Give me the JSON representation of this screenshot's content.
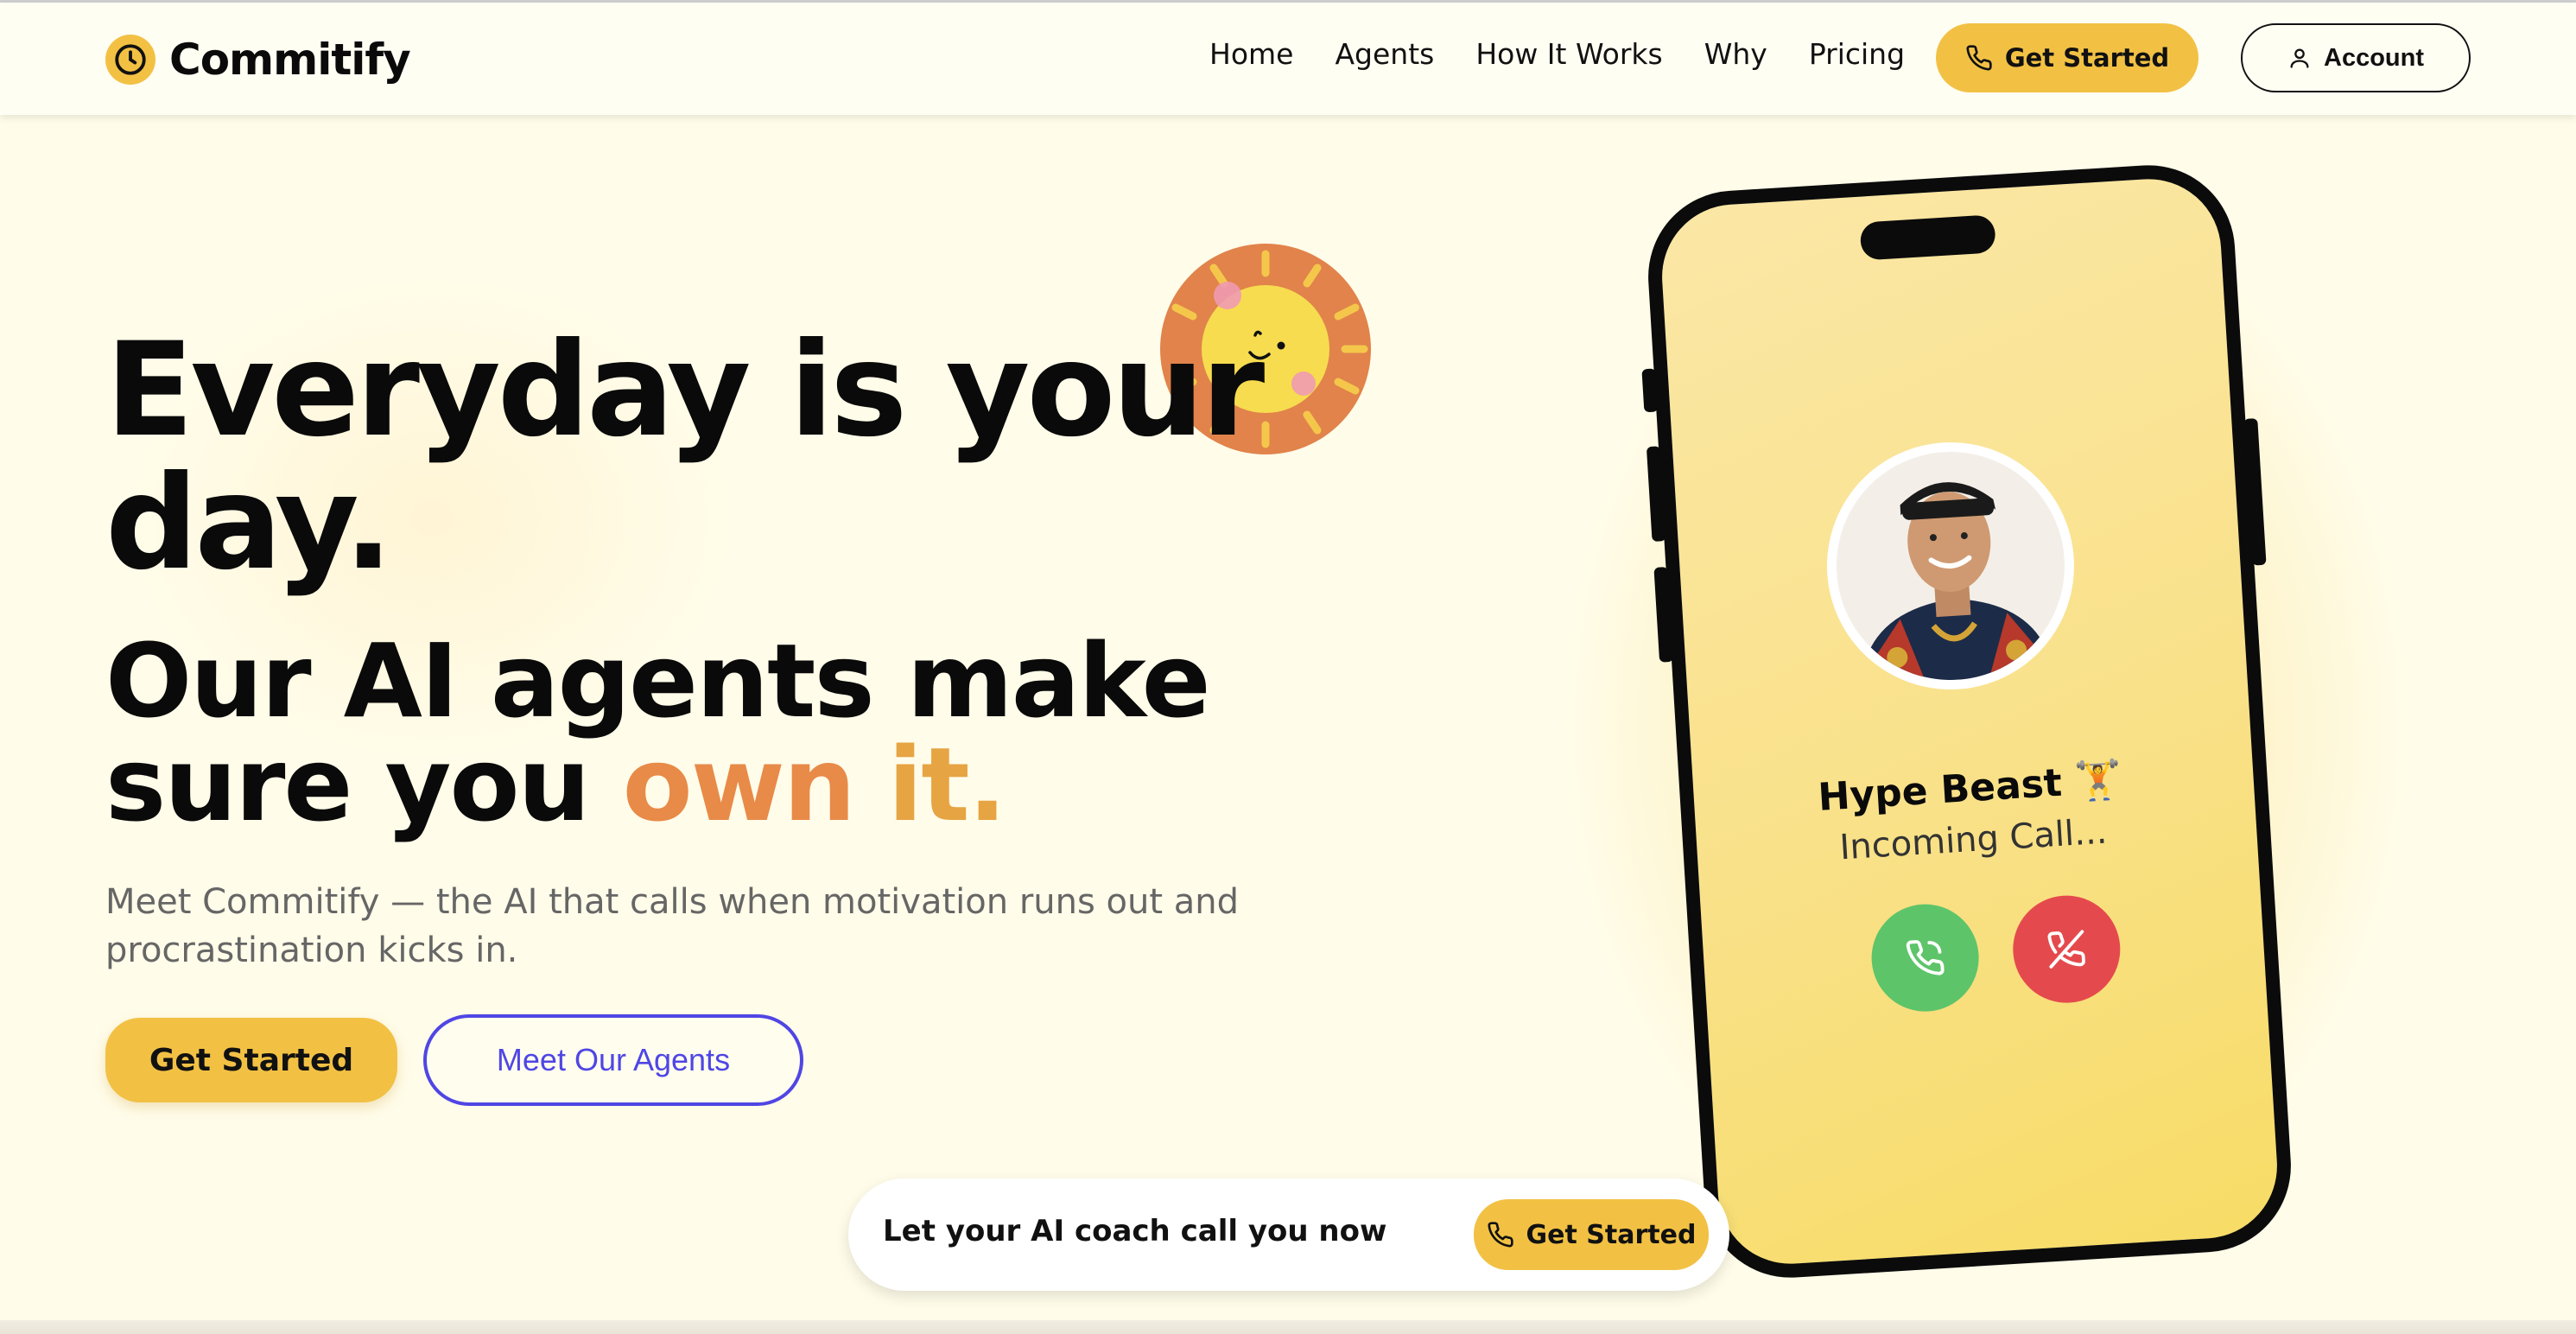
{
  "brand": {
    "name": "Commitify",
    "logo_icon": "clock-icon",
    "accent": "#f2c144"
  },
  "nav": {
    "links": [
      "Home",
      "Agents",
      "How It Works",
      "Why",
      "Pricing"
    ],
    "get_started": "Get Started",
    "account": "Account"
  },
  "hero": {
    "headline": "Everyday is your day.",
    "subheadline_start": "Our AI agents make sure you ",
    "subheadline_own": "own",
    "subheadline_it": " it.",
    "description": "Meet Commitify — the AI that calls when motivation runs out and procrastination kicks in.",
    "cta_primary": "Get Started",
    "cta_secondary": "Meet Our Agents"
  },
  "phone": {
    "caller_name": "Hype Beast 🏋️",
    "call_status": "Incoming Call...",
    "accept_icon": "phone-accept-icon",
    "decline_icon": "phone-decline-icon"
  },
  "bottom_bar": {
    "prompt": "Let your AI coach call you now",
    "button": "Get Started"
  },
  "colors": {
    "background": "#fffdee",
    "primary_yellow": "#f2c144",
    "indigo": "#4f46e5",
    "orange_accent": "#e88a48",
    "accept_green": "#5ec46a",
    "decline_red": "#e44a4d"
  }
}
